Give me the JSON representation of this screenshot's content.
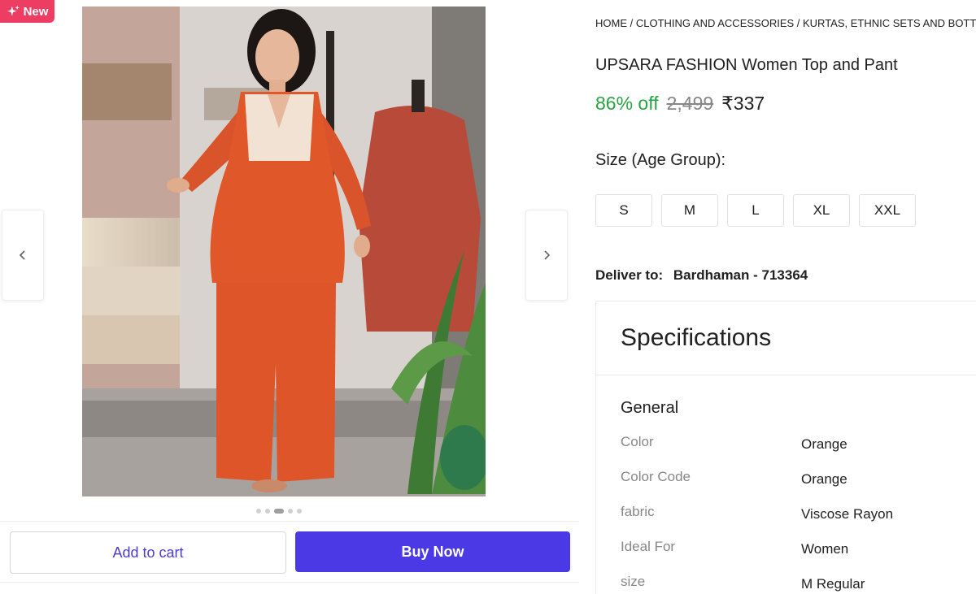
{
  "badge": {
    "label": "New",
    "icon": "sparkle-icon",
    "color": "#ee3d63"
  },
  "gallery": {
    "image_alt": "Woman wearing orange top and palazzo pant set",
    "dot_count": 5,
    "active_dot": 2
  },
  "actions": {
    "add_to_cart": "Add to cart",
    "buy_now": "Buy Now",
    "accent_color": "#4b39e5"
  },
  "breadcrumb": "HOME / CLOTHING AND ACCESSORIES / KURTAS, ETHNIC SETS AND BOTTOMS",
  "product": {
    "title": "UPSARA FASHION Women Top and Pant",
    "discount": "86% off",
    "mrp": "2,499",
    "price": "₹337"
  },
  "size_selector": {
    "label": "Size (Age Group):",
    "options": [
      "S",
      "M",
      "L",
      "XL",
      "XXL"
    ]
  },
  "delivery": {
    "label": "Deliver to:",
    "location": "Bardhaman - 713364"
  },
  "specifications": {
    "heading": "Specifications",
    "group": "General",
    "rows": [
      {
        "key": "Color",
        "value": "Orange"
      },
      {
        "key": "Color Code",
        "value": "Orange"
      },
      {
        "key": "fabric",
        "value": "Viscose Rayon"
      },
      {
        "key": "Ideal For",
        "value": "Women"
      },
      {
        "key": "size",
        "value": "M Regular"
      }
    ]
  }
}
